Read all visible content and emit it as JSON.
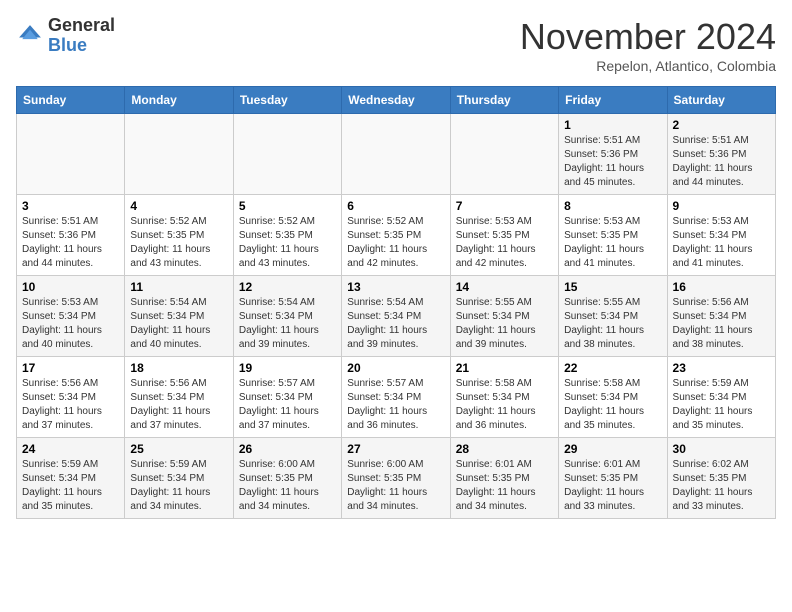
{
  "header": {
    "logo_general": "General",
    "logo_blue": "Blue",
    "month_title": "November 2024",
    "location": "Repelon, Atlantico, Colombia"
  },
  "days_of_week": [
    "Sunday",
    "Monday",
    "Tuesday",
    "Wednesday",
    "Thursday",
    "Friday",
    "Saturday"
  ],
  "weeks": [
    [
      {
        "day": "",
        "info": ""
      },
      {
        "day": "",
        "info": ""
      },
      {
        "day": "",
        "info": ""
      },
      {
        "day": "",
        "info": ""
      },
      {
        "day": "",
        "info": ""
      },
      {
        "day": "1",
        "info": "Sunrise: 5:51 AM\nSunset: 5:36 PM\nDaylight: 11 hours\nand 45 minutes."
      },
      {
        "day": "2",
        "info": "Sunrise: 5:51 AM\nSunset: 5:36 PM\nDaylight: 11 hours\nand 44 minutes."
      }
    ],
    [
      {
        "day": "3",
        "info": "Sunrise: 5:51 AM\nSunset: 5:36 PM\nDaylight: 11 hours\nand 44 minutes."
      },
      {
        "day": "4",
        "info": "Sunrise: 5:52 AM\nSunset: 5:35 PM\nDaylight: 11 hours\nand 43 minutes."
      },
      {
        "day": "5",
        "info": "Sunrise: 5:52 AM\nSunset: 5:35 PM\nDaylight: 11 hours\nand 43 minutes."
      },
      {
        "day": "6",
        "info": "Sunrise: 5:52 AM\nSunset: 5:35 PM\nDaylight: 11 hours\nand 42 minutes."
      },
      {
        "day": "7",
        "info": "Sunrise: 5:53 AM\nSunset: 5:35 PM\nDaylight: 11 hours\nand 42 minutes."
      },
      {
        "day": "8",
        "info": "Sunrise: 5:53 AM\nSunset: 5:35 PM\nDaylight: 11 hours\nand 41 minutes."
      },
      {
        "day": "9",
        "info": "Sunrise: 5:53 AM\nSunset: 5:34 PM\nDaylight: 11 hours\nand 41 minutes."
      }
    ],
    [
      {
        "day": "10",
        "info": "Sunrise: 5:53 AM\nSunset: 5:34 PM\nDaylight: 11 hours\nand 40 minutes."
      },
      {
        "day": "11",
        "info": "Sunrise: 5:54 AM\nSunset: 5:34 PM\nDaylight: 11 hours\nand 40 minutes."
      },
      {
        "day": "12",
        "info": "Sunrise: 5:54 AM\nSunset: 5:34 PM\nDaylight: 11 hours\nand 39 minutes."
      },
      {
        "day": "13",
        "info": "Sunrise: 5:54 AM\nSunset: 5:34 PM\nDaylight: 11 hours\nand 39 minutes."
      },
      {
        "day": "14",
        "info": "Sunrise: 5:55 AM\nSunset: 5:34 PM\nDaylight: 11 hours\nand 39 minutes."
      },
      {
        "day": "15",
        "info": "Sunrise: 5:55 AM\nSunset: 5:34 PM\nDaylight: 11 hours\nand 38 minutes."
      },
      {
        "day": "16",
        "info": "Sunrise: 5:56 AM\nSunset: 5:34 PM\nDaylight: 11 hours\nand 38 minutes."
      }
    ],
    [
      {
        "day": "17",
        "info": "Sunrise: 5:56 AM\nSunset: 5:34 PM\nDaylight: 11 hours\nand 37 minutes."
      },
      {
        "day": "18",
        "info": "Sunrise: 5:56 AM\nSunset: 5:34 PM\nDaylight: 11 hours\nand 37 minutes."
      },
      {
        "day": "19",
        "info": "Sunrise: 5:57 AM\nSunset: 5:34 PM\nDaylight: 11 hours\nand 37 minutes."
      },
      {
        "day": "20",
        "info": "Sunrise: 5:57 AM\nSunset: 5:34 PM\nDaylight: 11 hours\nand 36 minutes."
      },
      {
        "day": "21",
        "info": "Sunrise: 5:58 AM\nSunset: 5:34 PM\nDaylight: 11 hours\nand 36 minutes."
      },
      {
        "day": "22",
        "info": "Sunrise: 5:58 AM\nSunset: 5:34 PM\nDaylight: 11 hours\nand 35 minutes."
      },
      {
        "day": "23",
        "info": "Sunrise: 5:59 AM\nSunset: 5:34 PM\nDaylight: 11 hours\nand 35 minutes."
      }
    ],
    [
      {
        "day": "24",
        "info": "Sunrise: 5:59 AM\nSunset: 5:34 PM\nDaylight: 11 hours\nand 35 minutes."
      },
      {
        "day": "25",
        "info": "Sunrise: 5:59 AM\nSunset: 5:34 PM\nDaylight: 11 hours\nand 34 minutes."
      },
      {
        "day": "26",
        "info": "Sunrise: 6:00 AM\nSunset: 5:35 PM\nDaylight: 11 hours\nand 34 minutes."
      },
      {
        "day": "27",
        "info": "Sunrise: 6:00 AM\nSunset: 5:35 PM\nDaylight: 11 hours\nand 34 minutes."
      },
      {
        "day": "28",
        "info": "Sunrise: 6:01 AM\nSunset: 5:35 PM\nDaylight: 11 hours\nand 34 minutes."
      },
      {
        "day": "29",
        "info": "Sunrise: 6:01 AM\nSunset: 5:35 PM\nDaylight: 11 hours\nand 33 minutes."
      },
      {
        "day": "30",
        "info": "Sunrise: 6:02 AM\nSunset: 5:35 PM\nDaylight: 11 hours\nand 33 minutes."
      }
    ]
  ]
}
